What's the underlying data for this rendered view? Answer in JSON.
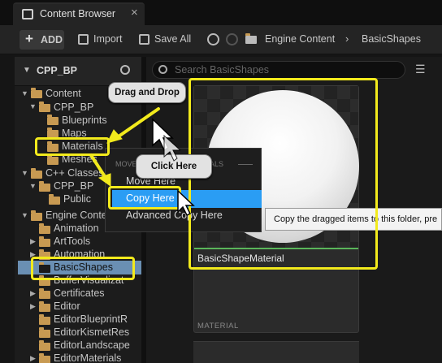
{
  "tab": {
    "title": "Content Browser",
    "close": "×"
  },
  "toolbar": {
    "add_label": "ADD",
    "import_label": "Import",
    "saveall_label": "Save All",
    "breadcrumb": [
      "Engine Content",
      "BasicShapes"
    ]
  },
  "sidebar": {
    "title": "CPP_BP",
    "tree": [
      {
        "label": "Content",
        "level": 0,
        "expanded": true
      },
      {
        "label": "CPP_BP",
        "level": 1,
        "expanded": true
      },
      {
        "label": "Blueprints",
        "level": 2
      },
      {
        "label": "Maps",
        "level": 2
      },
      {
        "label": "Materials",
        "level": 2
      },
      {
        "label": "Meshes",
        "level": 2
      },
      {
        "label": "C++ Classes",
        "level": 0,
        "expanded": true
      },
      {
        "label": "CPP_BP",
        "level": 1,
        "expanded": true
      },
      {
        "label": "Public",
        "level": 2
      },
      {
        "label": "Engine Conte",
        "level": 0,
        "expanded": true
      },
      {
        "label": "Animation",
        "level": 1
      },
      {
        "label": "ArtTools",
        "level": 1
      },
      {
        "label": "Automation",
        "level": 1
      },
      {
        "label": "BasicShapes",
        "level": 1,
        "selected": true
      },
      {
        "label": "BufferVisualizat",
        "level": 1
      },
      {
        "label": "Certificates",
        "level": 1
      },
      {
        "label": "Editor",
        "level": 1
      },
      {
        "label": "EditorBlueprintR",
        "level": 1
      },
      {
        "label": "EditorKismetRes",
        "level": 1
      },
      {
        "label": "EditorLandscape",
        "level": 1
      },
      {
        "label": "EditorMaterials",
        "level": 1
      }
    ]
  },
  "search": {
    "placeholder": "Search BasicShapes"
  },
  "asset": {
    "name": "BasicShapeMaterial",
    "type": "MATERIAL"
  },
  "context_menu": {
    "header_left": "MOVE",
    "header_right": "ALS",
    "items": [
      "Move Here",
      "Copy Here",
      "Advanced Copy Here"
    ]
  },
  "tooltip": {
    "text": "Copy the dragged items to this folder, pre"
  },
  "callouts": {
    "drag": "Drag and Drop",
    "click": "Click Here"
  },
  "colors": {
    "highlight": "#f2ea1c",
    "selection": "#2a9df4",
    "folder": "#c89a52"
  }
}
